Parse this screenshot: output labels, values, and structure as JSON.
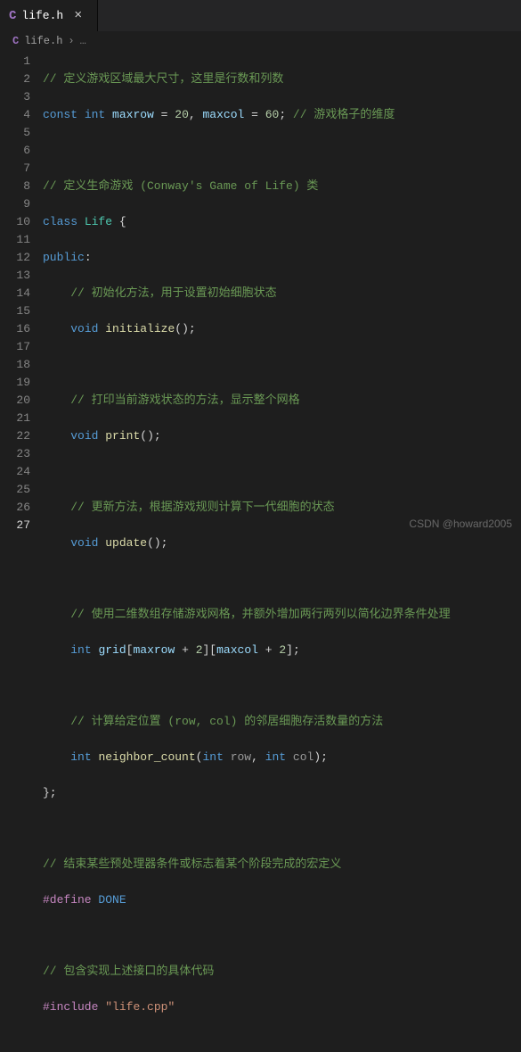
{
  "tab": {
    "icon_letter": "C",
    "file_name": "life.h",
    "close_glyph": "×"
  },
  "breadcrumb": {
    "icon_letter": "C",
    "file_name": "life.h",
    "sep": "›",
    "trailing": "…"
  },
  "line_numbers": [
    "1",
    "2",
    "3",
    "4",
    "5",
    "6",
    "7",
    "8",
    "9",
    "10",
    "11",
    "12",
    "13",
    "14",
    "15",
    "16",
    "17",
    "18",
    "19",
    "20",
    "21",
    "22",
    "23",
    "24",
    "25",
    "26",
    "27"
  ],
  "active_line_index": 26,
  "code": {
    "l1": {
      "cmt": "// 定义游戏区域最大尺寸，这里是行数和列数"
    },
    "l2": {
      "kw1": "const",
      "sp1": " ",
      "kw2": "int",
      "sp2": " ",
      "v1": "maxrow",
      "eq": " = ",
      "n1": "20",
      "cma": ", ",
      "v2": "maxcol",
      "eq2": " = ",
      "n2": "60",
      "semi": "; ",
      "cmt": "// 游戏格子的维度"
    },
    "l4": {
      "cmt": "// 定义生命游戏 (Conway's Game of Life) 类"
    },
    "l5": {
      "kw": "class",
      "sp": " ",
      "cls": "Life",
      "opn": " {"
    },
    "l6": {
      "kw": "public",
      "colon": ":"
    },
    "l7": {
      "cmt": "// 初始化方法，用于设置初始细胞状态"
    },
    "l8": {
      "kw": "void",
      "sp": " ",
      "fn": "initialize",
      "p": "();"
    },
    "l10": {
      "cmt": "// 打印当前游戏状态的方法，显示整个网格"
    },
    "l11": {
      "kw": "void",
      "sp": " ",
      "fn": "print",
      "p": "();"
    },
    "l13": {
      "cmt": "// 更新方法，根据游戏规则计算下一代细胞的状态"
    },
    "l14": {
      "kw": "void",
      "sp": " ",
      "fn": "update",
      "p": "();"
    },
    "l16": {
      "cmt": "// 使用二维数组存储游戏网格，并额外增加两行两列以简化边界条件处理"
    },
    "l17": {
      "kw": "int",
      "sp": " ",
      "var": "grid",
      "b1": "[",
      "v1": "maxrow",
      "plus1": " + ",
      "n1": "2",
      "b2": "][",
      "v2": "maxcol",
      "plus2": " + ",
      "n2": "2",
      "b3": "];"
    },
    "l19": {
      "cmt": "// 计算给定位置 (row, col) 的邻居细胞存活数量的方法"
    },
    "l20": {
      "kw": "int",
      "sp": " ",
      "fn": "neighbor_count",
      "p1": "(",
      "t1": "int",
      "sp2": " ",
      "a1": "row",
      "cma": ", ",
      "t2": "int",
      "sp3": " ",
      "a2": "col",
      "p2": ");"
    },
    "l21": {
      "close": "};"
    },
    "l23": {
      "cmt": "// 结束某些预处理器条件或标志着某个阶段完成的宏定义"
    },
    "l24": {
      "pp": "#define",
      "sp": " ",
      "mac": "DONE"
    },
    "l26": {
      "cmt": "// 包含实现上述接口的具体代码"
    },
    "l27": {
      "pp": "#include",
      "sp": " ",
      "str": "\"life.cpp\""
    }
  },
  "watermark": "CSDN @howard2005"
}
